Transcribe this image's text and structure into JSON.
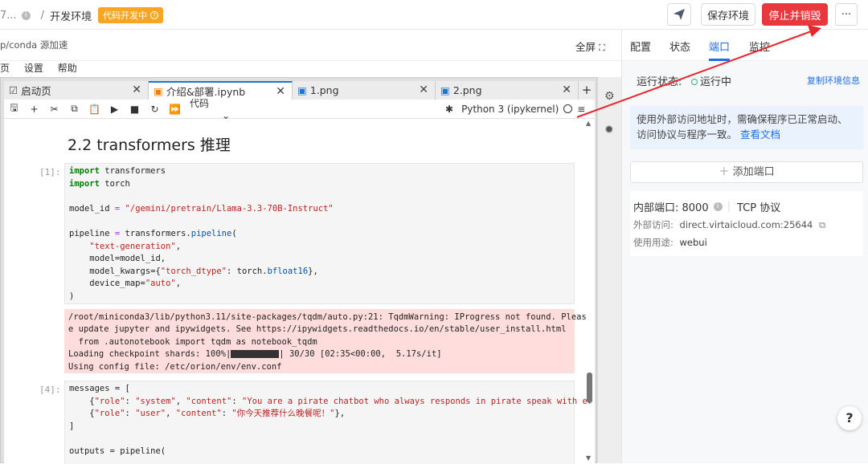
{
  "header": {
    "crumb_prefix": "7...",
    "crumb_title": "开发环境",
    "status_badge": "代码开发中",
    "publish_icon": "send-icon",
    "save_env": "保存环境",
    "stop_destroy": "停止并销毁",
    "more": "···"
  },
  "left_top": {
    "path_label": "p/conda 源加速",
    "fullscreen": "全屏"
  },
  "menu": [
    "页",
    "设置",
    "帮助"
  ],
  "tabs": [
    {
      "icon": "☑",
      "label": "启动页"
    },
    {
      "icon": "▣",
      "label": "介绍&部署.ipynb"
    },
    {
      "icon": "▣",
      "label": "1.png"
    },
    {
      "icon": "▣",
      "label": "2.png"
    }
  ],
  "toolbar": {
    "cell_type": "代码",
    "kernel": "Python 3 (ipykernel)"
  },
  "notebook": {
    "heading": "2.2 transformers 推理",
    "prompt1": "[1]:",
    "prompt4": "[4]:",
    "cell1": {
      "l1_kw": "import",
      "l1": " transformers",
      "l2_kw": "import",
      "l2": " torch",
      "l4a": "model_id ",
      "l4op": "=",
      "l4str": " \"/gemini/pretrain/Llama-3.3-70B-Instruct\"",
      "l6a": "pipeline ",
      "l6op": "=",
      "l6b": " transformers.",
      "l6fn": "pipeline",
      "l6c": "(",
      "l7str": "\"text-generation\"",
      "l7c": ",",
      "l8": "    model=model_id,",
      "l9a": "    model_kwargs=",
      "l9b": "{",
      "l9str": "\"torch_dtype\"",
      "l9c": ": torch.",
      "l9fn": "bfloat16",
      "l9d": "},",
      "l10a": "    device_map=",
      "l10str": "\"auto\"",
      "l10c": ",",
      "l11": ")"
    },
    "stderr": {
      "l1": "/root/miniconda3/lib/python3.11/site-packages/tqdm/auto.py:21: TqdmWarning: IProgress not found. Pleas",
      "l2": "e update jupyter and ipywidgets. See https://ipywidgets.readthedocs.io/en/stable/user_install.html",
      "l3": "  from .autonotebook import tqdm as notebook_tqdm",
      "l4a": "Loading checkpoint shards: 100%|",
      "l4b": "| 30/30 [02:35<00:00,  5.17s/it]",
      "l5": "Using config file: /etc/orion/env/env.conf"
    },
    "cell4": {
      "l1": "messages = [",
      "l2a": "    {",
      "l2s1": "\"role\"",
      "l2b": ": ",
      "l2s2": "\"system\"",
      "l2c": ", ",
      "l2s3": "\"content\"",
      "l2d": ": ",
      "l2s4": "\"You are a pirate chatbot who always responds in pirate speak with er",
      "l3a": "    {",
      "l3s1": "\"role\"",
      "l3b": ": ",
      "l3s2": "\"user\"",
      "l3c": ", ",
      "l3s3": "\"content\"",
      "l3d": ": ",
      "l3s4": "\"你今天推荐什么晚餐呢！\"",
      "l3e": "},",
      "l4": "]",
      "l6": "outputs = pipeline("
    }
  },
  "right_panel": {
    "tabs": [
      "配置",
      "状态",
      "端口",
      "监控"
    ],
    "active_tab": "端口",
    "run_status_label": "运行状态:",
    "run_status_value": "运行中",
    "copy_env_info": "复制环境信息",
    "notice_a": "使用外部访问地址时，需确保程序已正常启动、访问协议与程序一致。",
    "notice_link": "查看文档",
    "add_port": "添加端口",
    "inner_port_label": "内部端口: 8000",
    "protocol": "TCP 协议",
    "external_label": "外部访问:",
    "external_value": "direct.virtaicloud.com:25644",
    "usage_label": "使用用途:",
    "usage_value": "webui"
  },
  "help": "?",
  "colors": {
    "accent": "#1e6ee8",
    "danger": "#e8383d",
    "badge": "#f6a623"
  }
}
